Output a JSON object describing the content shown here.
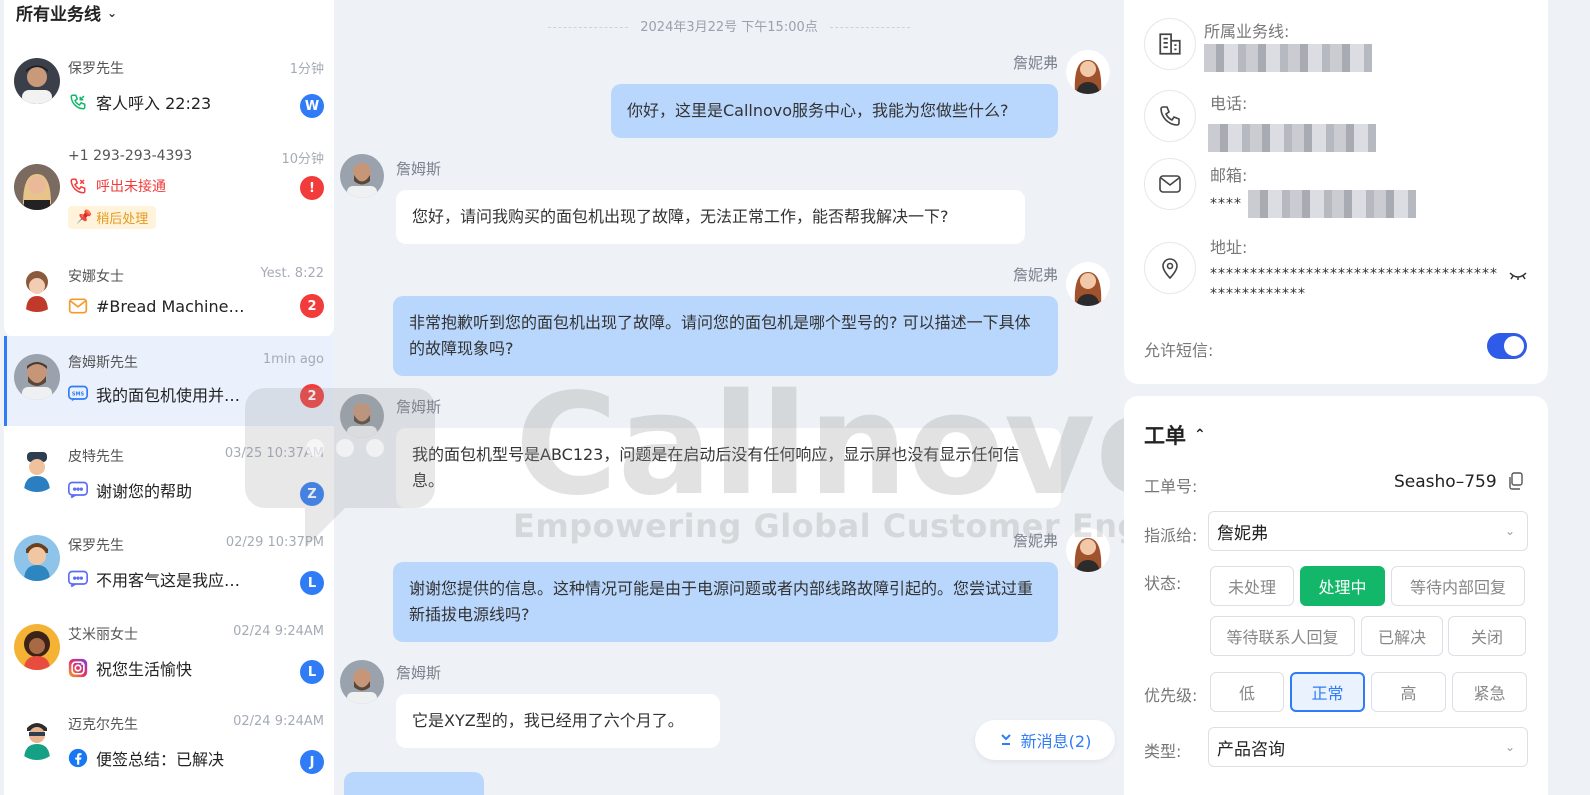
{
  "left": {
    "filter_label": "所有业务线",
    "conversations": [
      {
        "name": "保罗先生",
        "time": "1分钟",
        "message": "客人呼入 22:23",
        "badge": "W"
      },
      {
        "name": "+1 293-293-4393",
        "time": "10分钟",
        "message": "呼出未接通",
        "badge": "!",
        "tag": "稍后处理"
      },
      {
        "name": "安娜女士",
        "time": "Yest. 8:22",
        "message": "#Bread Machine…",
        "badge": "2"
      },
      {
        "name": "詹姆斯先生",
        "time": "1min ago",
        "message": "我的面包机使用并…",
        "badge": "2"
      },
      {
        "name": "皮特先生",
        "time": "03/25 10:37AM",
        "message": "谢谢您的帮助",
        "badge": "Z"
      },
      {
        "name": "保罗先生",
        "time": "02/29 10:37PM",
        "message": "不用客气这是我应…",
        "badge": "L"
      },
      {
        "name": "艾米丽女士",
        "time": "02/24 9:24AM",
        "message": "祝您生活愉快",
        "badge": "L"
      },
      {
        "name": "迈克尔先生",
        "time": "02/24 9:24AM",
        "message": "便签总结：已解决",
        "badge": "J"
      }
    ]
  },
  "chat": {
    "date": "2024年3月22号 下午15:00点",
    "messages": [
      {
        "sender": "詹妮弗",
        "text": "你好，这里是Callnovo服务中心，我能为您做些什么?"
      },
      {
        "sender": "詹姆斯",
        "text": "您好，请问我购买的面包机出现了故障，无法正常工作，能否帮我解决一下?"
      },
      {
        "sender": "詹妮弗",
        "text": "非常抱歉听到您的面包机出现了故障。请问您的面包机是哪个型号的? 可以描述一下具体的故障现象吗?"
      },
      {
        "sender": "詹姆斯",
        "text": "我的面包机型号是ABC123，问题是在启动后没有任何响应，显示屏也没有显示任何信息。"
      },
      {
        "sender": "詹妮弗",
        "text": "谢谢您提供的信息。这种情况可能是由于电源问题或者内部线路故障引起的。您尝试过重新插拔电源线吗?"
      },
      {
        "sender": "詹姆斯",
        "text": "它是XYZ型的，我已经用了六个月了。"
      }
    ],
    "new_messages_label": "新消息(2)",
    "watermark_brand": "Callnovo",
    "watermark_slogan": "Empowering Global Customer Engagement"
  },
  "contact": {
    "business_line_label": "所属业务线:",
    "phone_label": "电话:",
    "email_label": "邮箱:",
    "email_masked": "****",
    "address_label": "地址:",
    "address_masked_line1": "************************************",
    "address_masked_line2": "************",
    "allow_sms_label": "允许短信:",
    "allow_sms_on": true
  },
  "ticket": {
    "title": "工单",
    "number_label": "工单号:",
    "number_value": "Seasho–759",
    "assignee_label": "指派给:",
    "assignee_value": "詹妮弗",
    "status_label": "状态:",
    "statuses": [
      "未处理",
      "处理中",
      "等待内部回复",
      "等待联系人回复",
      "已解决",
      "关闭"
    ],
    "status_selected": "处理中",
    "priority_label": "优先级:",
    "priorities": [
      "低",
      "正常",
      "高",
      "紧急"
    ],
    "priority_selected": "正常",
    "type_label": "类型:",
    "type_value": "产品咨询"
  },
  "colors": {
    "accent": "#2f7cf6",
    "status_active": "#12b76a",
    "alert": "#f23b3b",
    "my_bubble": "#b9d7fc"
  }
}
